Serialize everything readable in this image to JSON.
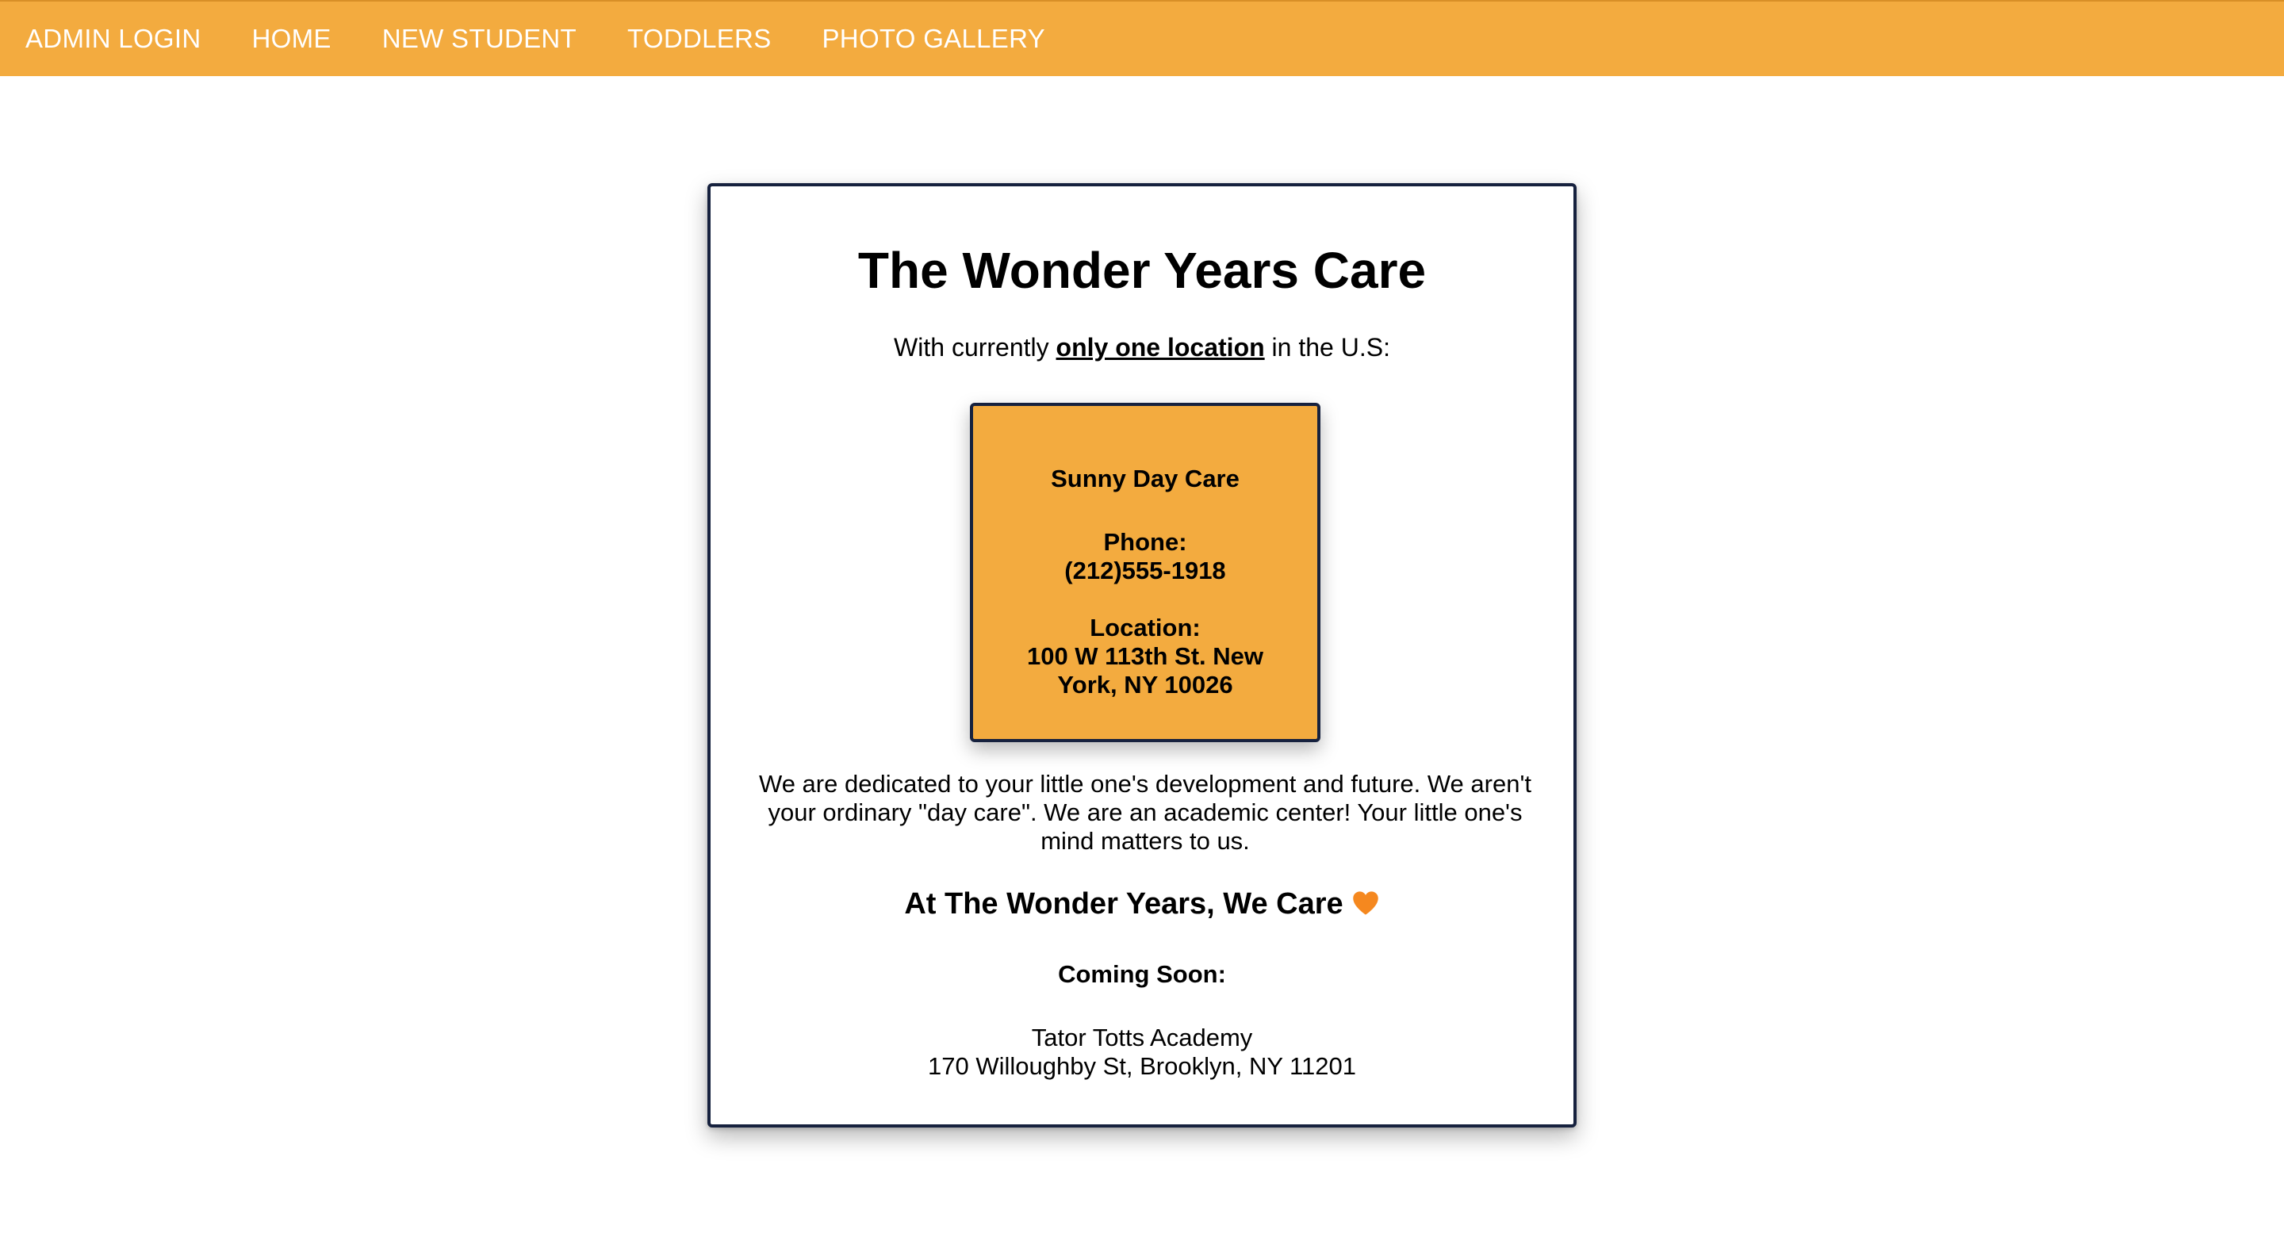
{
  "nav": {
    "items": [
      {
        "label": "ADMIN LOGIN"
      },
      {
        "label": "HOME"
      },
      {
        "label": "NEW STUDENT"
      },
      {
        "label": "TODDLERS"
      },
      {
        "label": "PHOTO GALLERY"
      }
    ]
  },
  "main": {
    "title": "The Wonder Years Care",
    "intro_prefix": "With currently ",
    "intro_emphasis": "only one location",
    "intro_suffix": " in the U.S:",
    "location": {
      "name": "Sunny Day Care",
      "phone_label": "Phone:",
      "phone": "(212)555-1918",
      "location_label": "Location:",
      "address": "100 W 113th St. New York, NY 10026"
    },
    "description": "We are dedicated to your little one's development and future. We aren't your ordinary \"day care\". We are an academic center! Your little one's mind matters to us.",
    "tagline": "At The Wonder Years, We Care",
    "coming_soon_label": "Coming Soon:",
    "future_location": {
      "name": "Tator Totts Academy",
      "address": "170 Willoughby St, Brooklyn, NY 11201"
    }
  },
  "colors": {
    "accent": "#f3ab3f",
    "border": "#16213e",
    "heart": "#f5881f"
  },
  "icons": {
    "tagline_icon": "orange-heart-icon"
  }
}
